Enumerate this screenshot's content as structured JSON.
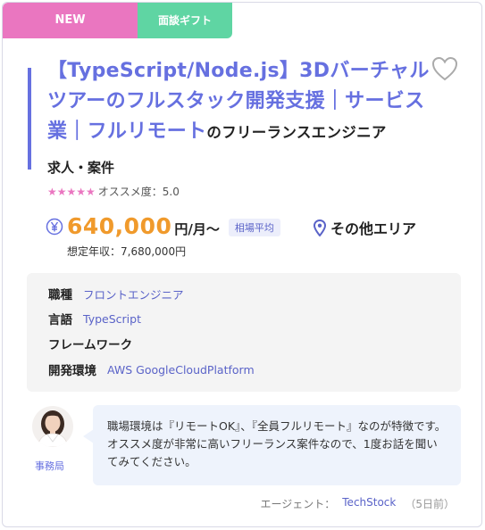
{
  "badges": {
    "new": "NEW",
    "gift": "面談ギフト"
  },
  "job": {
    "title_main": "【TypeScript/Node.js】3Dバーチャルツアーのフルスタック開発支援｜サービス業｜フルリモート",
    "title_suffix": "のフリーランスエンジニア",
    "subtitle": "求人・案件",
    "stars": "★★★★★",
    "rating_text": "オススメ度：5.0",
    "salary_amount": "640,000",
    "salary_unit": "円/月～",
    "market_badge": "相場平均",
    "area": "その他エリア",
    "annual": "想定年収：7,680,000円"
  },
  "details": {
    "rows": [
      {
        "label": "職種",
        "value": "フロントエンジニア"
      },
      {
        "label": "言語",
        "value": "TypeScript"
      },
      {
        "label": "フレームワーク",
        "value": ""
      },
      {
        "label": "開発環境",
        "value": "AWS GoogleCloudPlatform"
      }
    ]
  },
  "comment": {
    "avatar_label": "事務局",
    "text": "職場環境は『リモートOK』、『全員フルリモート』なのが特徴です。 オススメ度が非常に高いフリーランス案件なので、1度お話を聞いてみてください。"
  },
  "agent": {
    "label": "エージェント：",
    "name": "TechStock",
    "date": "（5日前）"
  },
  "colors": {
    "accent": "#6670e0",
    "salary": "#f09a2c",
    "new_badge": "#ea76c0",
    "gift_badge": "#5fd5a3"
  }
}
